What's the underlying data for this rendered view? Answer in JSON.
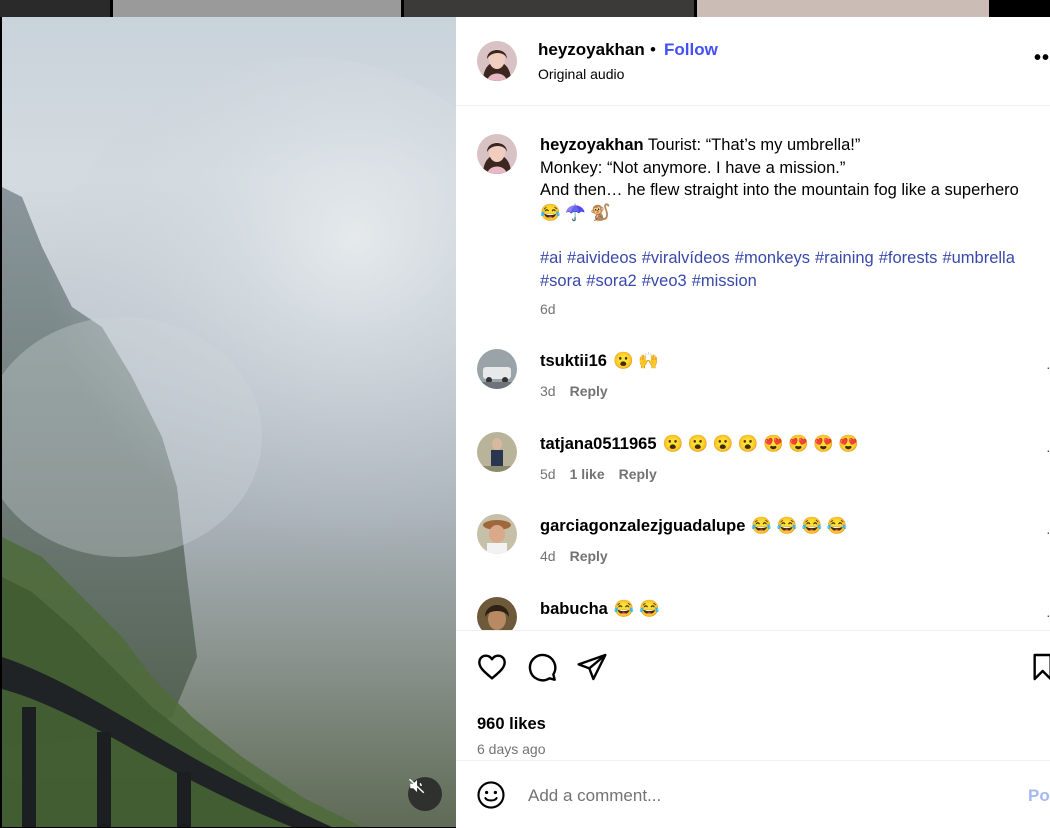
{
  "header": {
    "username": "heyzoyakhan",
    "separator": "•",
    "follow_label": "Follow",
    "audio_label": "Original audio",
    "more_icon": "more-options-icon",
    "more_glyph": "••"
  },
  "caption": {
    "username": "heyzoyakhan",
    "line1": "Tourist: “That’s my umbrella!”",
    "line2": "Monkey: “Not anymore. I have a mission.”",
    "line3": "And then… he flew straight into the mountain fog like a superhero",
    "emojis": "😂 ☂️ 🐒",
    "hashtags": [
      "#ai",
      "#aivideos",
      "#viralvídeos",
      "#monkeys",
      "#raining",
      "#forests",
      "#umbrella",
      "#sora",
      "#sora2",
      "#veo3",
      "#mission"
    ],
    "time": "6d"
  },
  "comments": [
    {
      "username": "tsuktii16",
      "text": "😮 🙌",
      "time": "3d",
      "likes": "",
      "reply": "Reply"
    },
    {
      "username": "tatjana0511965",
      "text": "😮 😮 😮 😮 😍 😍 😍 😍",
      "time": "5d",
      "likes": "1 like",
      "reply": "Reply"
    },
    {
      "username": "garciagonzalezjguadalupe",
      "text": "😂 😂 😂 😂",
      "time": "4d",
      "likes": "",
      "reply": "Reply"
    },
    {
      "username": "babucha",
      "text": "😂 😂",
      "time": "",
      "likes": "",
      "reply": ""
    }
  ],
  "actions": {
    "like_icon": "heart-icon",
    "comment_icon": "comment-icon",
    "share_icon": "share-icon",
    "save_icon": "bookmark-icon",
    "likes_count": "960 likes",
    "post_time": "6 days ago"
  },
  "comment_box": {
    "emoji_icon": "emoji-icon",
    "placeholder": "Add a comment...",
    "post_label": "Post"
  },
  "video": {
    "mute_icon": "muted-speaker-icon"
  },
  "colors": {
    "follow": "#4150f7",
    "hashtag": "#3949ab",
    "muted_text": "#737373",
    "post_disabled": "#a5b8f2"
  }
}
